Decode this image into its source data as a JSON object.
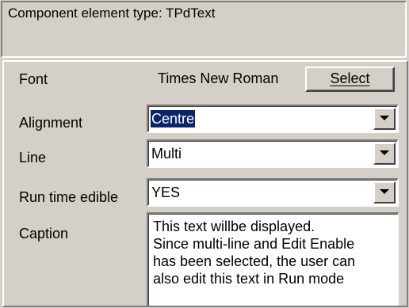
{
  "header": {
    "title": "Component element type: TPdText"
  },
  "properties": {
    "font": {
      "label": "Font",
      "value": "Times New Roman",
      "button_label": "Select"
    },
    "alignment": {
      "label": "Alignment",
      "value": "Centre",
      "selected": true
    },
    "line": {
      "label": "Line",
      "value": "Multi"
    },
    "run_time_edible": {
      "label": "Run time edible",
      "value": "YES"
    },
    "caption": {
      "label": "Caption",
      "lines": [
        "This text willbe displayed.",
        "Since multi-line and Edit Enable",
        "has been selected, the user can",
        "also edit this text in Run mode"
      ]
    }
  },
  "icons": {
    "dropdown": "chevron-down-icon"
  },
  "colors": {
    "face": "#d4d0c8",
    "selection": "#0a246a",
    "field": "#ffffff"
  }
}
